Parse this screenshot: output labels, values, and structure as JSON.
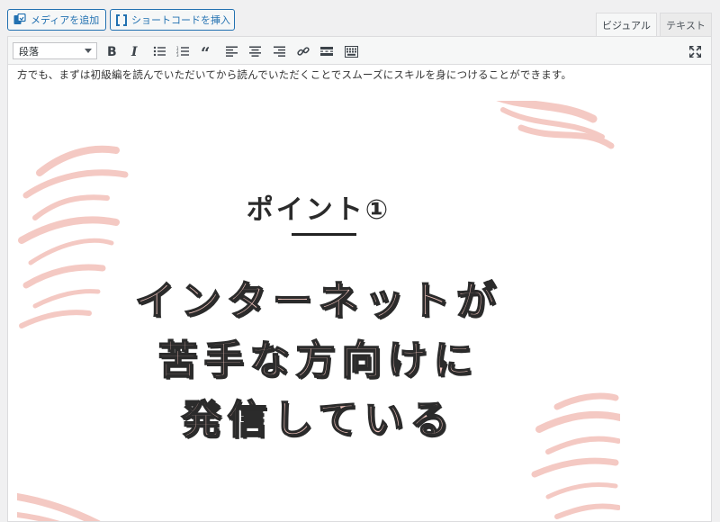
{
  "media_buttons": {
    "add_media": "メディアを追加",
    "insert_shortcode": "ショートコードを挿入"
  },
  "editor_tabs": {
    "visual": "ビジュアル",
    "text": "テキスト"
  },
  "toolbar": {
    "format_select": "段落",
    "buttons": [
      "bold-icon",
      "italic-icon",
      "bullet-list-icon",
      "numbered-list-icon",
      "blockquote-icon",
      "align-left-icon",
      "align-center-icon",
      "align-right-icon",
      "link-icon",
      "read-more-icon",
      "toolbar-toggle-icon",
      "fullscreen-icon"
    ]
  },
  "content": {
    "paragraph": "方でも、まずは初級編を読んでいただいてから読んでいただくことでスムーズにスキルを身につけることができます。",
    "image": {
      "title": "ポイント①",
      "lines": [
        "インターネットが",
        "苦手な方向けに",
        "発信している"
      ]
    }
  },
  "colors": {
    "accent": "#2271b1",
    "brush_pink": "#f4c7c0",
    "outline": "#2b2b2b"
  }
}
